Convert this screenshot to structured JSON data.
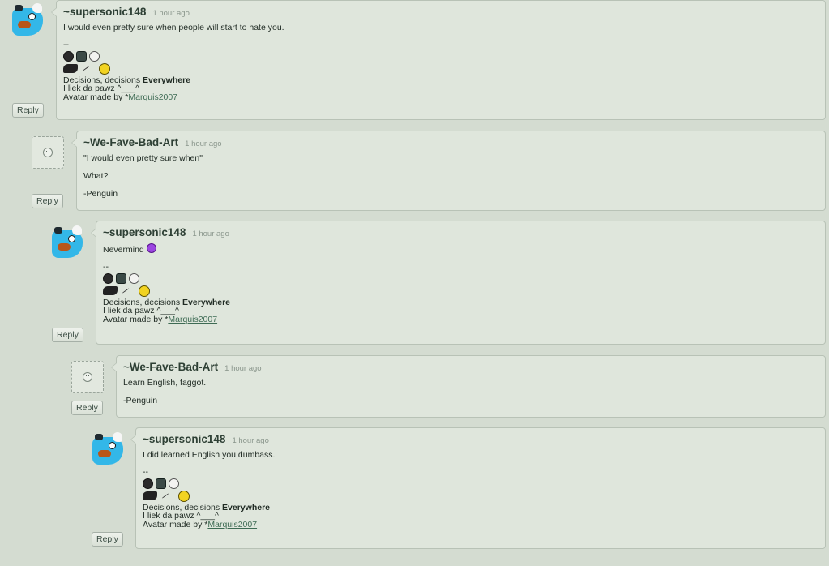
{
  "comments": [
    {
      "author": "~supersonic148",
      "time": "1 hour ago",
      "lines": [
        "I would even pretty sure when people will start to hate you."
      ],
      "sig": {
        "sep": "--",
        "decisions_prefix": "Decisions, decisions ",
        "decisions_bold": "Everywhere",
        "paws": "I liek da pawz ^___^",
        "avatar_prefix": "Avatar made by ",
        "avatar_symbol": "*",
        "avatar_user": "Marquis2007"
      },
      "reply_label": "Reply"
    },
    {
      "author": "~We-Fave-Bad-Art",
      "time": "1 hour ago",
      "lines": [
        "\"I would even pretty sure when\"",
        "What?",
        "-Penguin"
      ],
      "reply_label": "Reply"
    },
    {
      "author": "~supersonic148",
      "time": "1 hour ago",
      "lines": [
        "Nevermind"
      ],
      "emoticon": "purple-smiley-icon",
      "sig": {
        "sep": "--",
        "decisions_prefix": "Decisions, decisions ",
        "decisions_bold": "Everywhere",
        "paws": "I liek da pawz ^___^",
        "avatar_prefix": "Avatar made by ",
        "avatar_symbol": "*",
        "avatar_user": "Marquis2007"
      },
      "reply_label": "Reply"
    },
    {
      "author": "~We-Fave-Bad-Art",
      "time": "1 hour ago",
      "lines": [
        "Learn English, faggot.",
        "-Penguin"
      ],
      "reply_label": "Reply"
    },
    {
      "author": "~supersonic148",
      "time": "1 hour ago",
      "lines": [
        "I did learned English you dumbass."
      ],
      "sig": {
        "sep": "--",
        "decisions_prefix": "Decisions, decisions ",
        "decisions_bold": "Everywhere",
        "paws": "I liek da pawz ^___^",
        "avatar_prefix": "Avatar made by ",
        "avatar_symbol": "*",
        "avatar_user": "Marquis2007"
      },
      "reply_label": "Reply"
    }
  ],
  "colors": {
    "background": "#d4dcd1",
    "box": "#dfe6dc",
    "author": "#2e4035",
    "link": "#3e6b54",
    "mascot_blue": "#33b7e8"
  },
  "icons": [
    "mascot-avatar-icon",
    "blank-avatar-icon",
    "dark-orb-icon",
    "cat-icon",
    "troll-face-icon",
    "ninja-face-icon",
    "yellow-smiley-icon",
    "purple-smiley-icon"
  ]
}
